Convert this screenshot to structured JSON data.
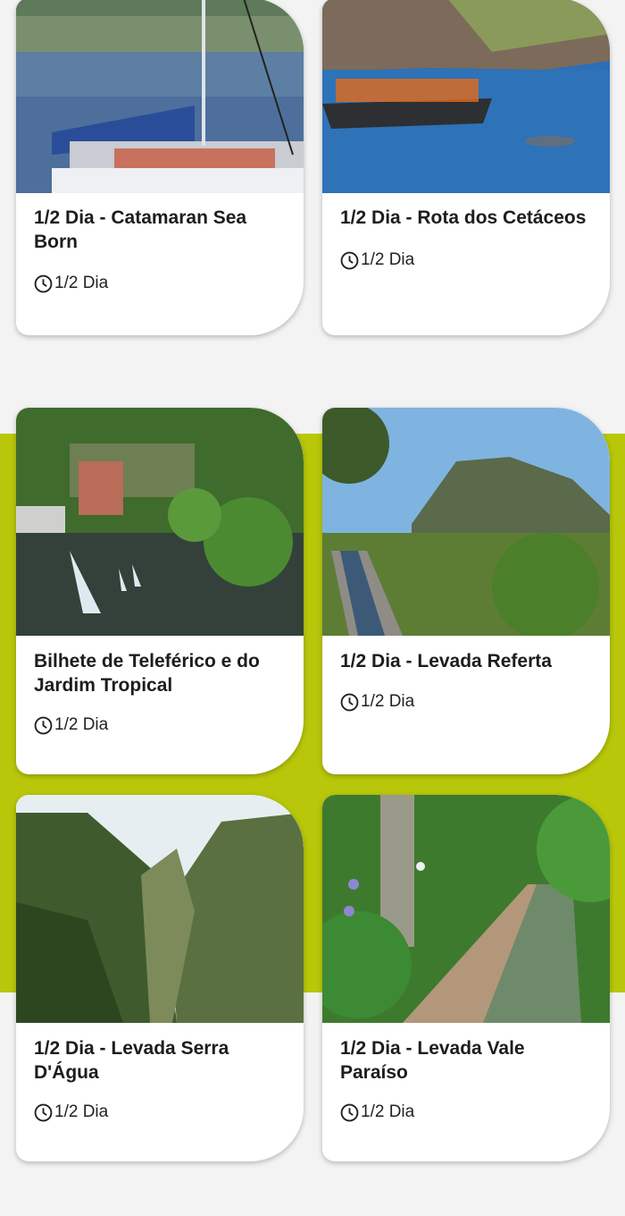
{
  "tours": [
    {
      "title": "1/2 Dia - Catamaran Sea Born",
      "duration": "1/2 Dia",
      "image": "catamaran-photo"
    },
    {
      "title": "1/2 Dia - Rota dos Cetáceos",
      "duration": "1/2 Dia",
      "image": "dolphin-boat-photo"
    },
    {
      "title": "Bilhete de Teleférico e do Jardim Tropical",
      "duration": "1/2 Dia",
      "image": "tropical-garden-photo"
    },
    {
      "title": "1/2 Dia - Levada Referta",
      "duration": "1/2 Dia",
      "image": "mountain-levada-photo"
    },
    {
      "title": "1/2 Dia - Levada Serra D'Água",
      "duration": "1/2 Dia",
      "image": "valley-photo"
    },
    {
      "title": "1/2 Dia - Levada Vale Paraíso",
      "duration": "1/2 Dia",
      "image": "forest-levada-photo"
    }
  ],
  "colors": {
    "accent": "#b8c70a",
    "background": "#f3f3f3",
    "card": "#ffffff",
    "text": "#1d1d1d"
  },
  "icons": {
    "duration": "clock-icon"
  }
}
